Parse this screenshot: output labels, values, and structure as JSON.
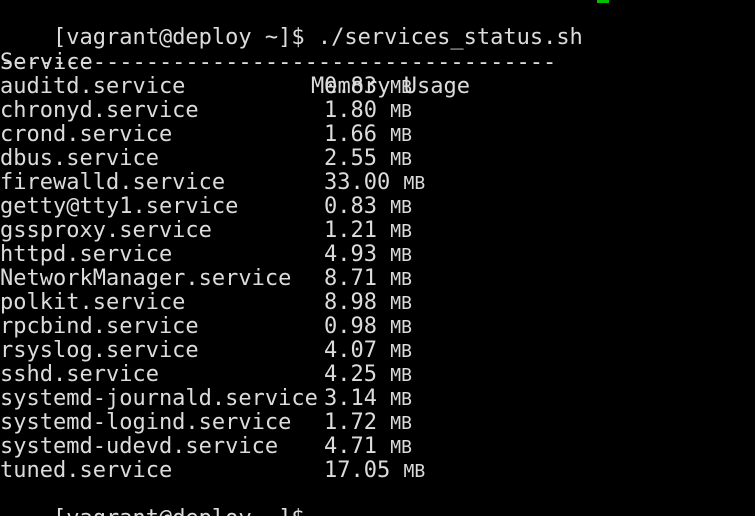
{
  "terminal": {
    "command_prompt": "[vagrant@deploy ~]$",
    "command": " ./services_status.sh",
    "header_service": "Service",
    "header_memory": "Memory Usage",
    "separator": "------------------------------------------",
    "rows": [
      {
        "service": "auditd.service",
        "mem": "0.83",
        "unit": "MB"
      },
      {
        "service": "chronyd.service",
        "mem": "1.80",
        "unit": "MB"
      },
      {
        "service": "crond.service",
        "mem": "1.66",
        "unit": "MB"
      },
      {
        "service": "dbus.service",
        "mem": "2.55",
        "unit": "MB"
      },
      {
        "service": "firewalld.service",
        "mem": "33.00",
        "unit": "MB"
      },
      {
        "service": "getty@tty1.service",
        "mem": "0.83",
        "unit": "MB"
      },
      {
        "service": "gssproxy.service",
        "mem": "1.21",
        "unit": "MB"
      },
      {
        "service": "httpd.service",
        "mem": "4.93",
        "unit": "MB"
      },
      {
        "service": "NetworkManager.service",
        "mem": "8.71",
        "unit": "MB"
      },
      {
        "service": "polkit.service",
        "mem": "8.98",
        "unit": "MB"
      },
      {
        "service": "rpcbind.service",
        "mem": "0.98",
        "unit": "MB"
      },
      {
        "service": "rsyslog.service",
        "mem": "4.07",
        "unit": "MB"
      },
      {
        "service": "sshd.service",
        "mem": "4.25",
        "unit": "MB"
      },
      {
        "service": "systemd-journald.service",
        "mem": "3.14",
        "unit": "MB"
      },
      {
        "service": "systemd-logind.service",
        "mem": "1.72",
        "unit": "MB"
      },
      {
        "service": "systemd-udevd.service",
        "mem": "4.71",
        "unit": "MB"
      },
      {
        "service": "tuned.service",
        "mem": "17.05",
        "unit": "MB"
      }
    ],
    "final_prompt": "[vagrant@deploy ~]$"
  },
  "colors": {
    "background": "#000000",
    "text": "#dcdcdc",
    "cursor_accent": "#00c000"
  }
}
